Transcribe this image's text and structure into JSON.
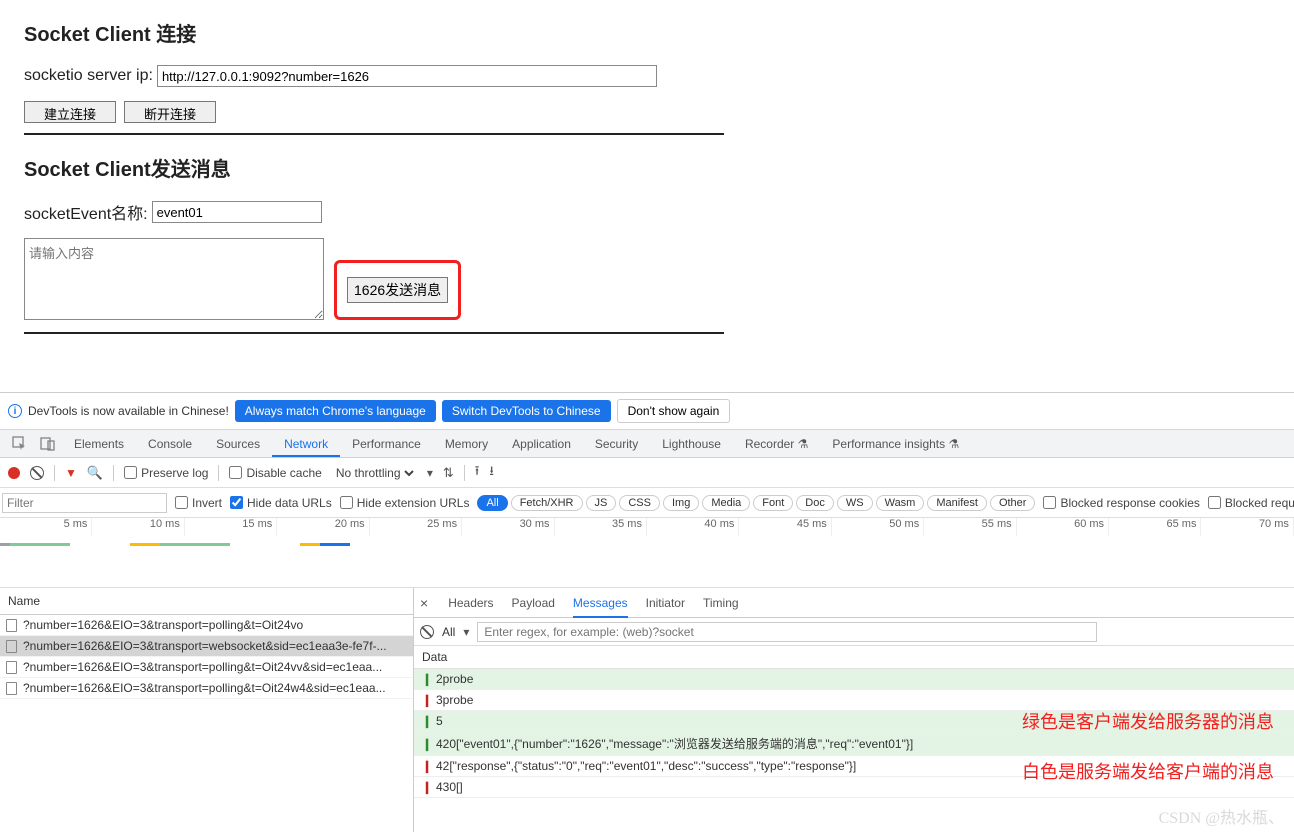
{
  "page": {
    "h1": "Socket Client 连接",
    "ip_label": "socketio server ip:",
    "ip_value": "http://127.0.0.1:9092?number=1626",
    "connect_btn": "建立连接",
    "disconnect_btn": "断开连接",
    "h2": "Socket Client发送消息",
    "event_label": "socketEvent名称:",
    "event_value": "event01",
    "msg_placeholder": "请输入内容",
    "send_btn": "1626发送消息"
  },
  "langbar": {
    "text": "DevTools is now available in Chinese!",
    "b1": "Always match Chrome's language",
    "b2": "Switch DevTools to Chinese",
    "b3": "Don't show again"
  },
  "tabs": [
    "Elements",
    "Console",
    "Sources",
    "Network",
    "Performance",
    "Memory",
    "Application",
    "Security",
    "Lighthouse",
    "Recorder ⚗",
    "Performance insights ⚗"
  ],
  "active_tab": "Network",
  "toolbar": {
    "preserve": "Preserve log",
    "disable_cache": "Disable cache",
    "throttling": "No throttling"
  },
  "filter": {
    "placeholder": "Filter",
    "invert": "Invert",
    "hide_data": "Hide data URLs",
    "hide_ext": "Hide extension URLs",
    "pills": [
      "All",
      "Fetch/XHR",
      "JS",
      "CSS",
      "Img",
      "Media",
      "Font",
      "Doc",
      "WS",
      "Wasm",
      "Manifest",
      "Other"
    ],
    "blocked_cookies": "Blocked response cookies",
    "blocked_req": "Blocked requests"
  },
  "timeline_labels": [
    "5 ms",
    "10 ms",
    "15 ms",
    "20 ms",
    "25 ms",
    "30 ms",
    "35 ms",
    "40 ms",
    "45 ms",
    "50 ms",
    "55 ms",
    "60 ms",
    "65 ms",
    "70 ms"
  ],
  "requests": {
    "head": "Name",
    "rows": [
      "?number=1626&EIO=3&transport=polling&t=Oit24vo",
      "?number=1626&EIO=3&transport=websocket&sid=ec1eaa3e-fe7f-...",
      "?number=1626&EIO=3&transport=polling&t=Oit24vv&sid=ec1eaa...",
      "?number=1626&EIO=3&transport=polling&t=Oit24w4&sid=ec1eaa..."
    ],
    "selected": 1
  },
  "detail": {
    "tabs": [
      "Headers",
      "Payload",
      "Messages",
      "Initiator",
      "Timing"
    ],
    "active": "Messages",
    "all": "All",
    "regex_ph": "Enter regex, for example: (web)?socket",
    "data_head": "Data",
    "rows": [
      {
        "dir": "up",
        "text": "2probe"
      },
      {
        "dir": "down",
        "text": "3probe"
      },
      {
        "dir": "up",
        "text": "5"
      },
      {
        "dir": "up",
        "text": "420[\"event01\",{\"number\":\"1626\",\"message\":\"浏览器发送给服务端的消息\",\"req\":\"event01\"}]"
      },
      {
        "dir": "down",
        "text": "42[\"response\",{\"status\":\"0\",\"req\":\"event01\",\"desc\":\"success\",\"type\":\"response\"}]"
      },
      {
        "dir": "down",
        "text": "430[]"
      }
    ]
  },
  "annotations": {
    "a1": "绿色是客户端发给服务器的消息",
    "a2": "白色是服务端发给客户端的消息"
  },
  "watermark": "CSDN @热水瓶、"
}
